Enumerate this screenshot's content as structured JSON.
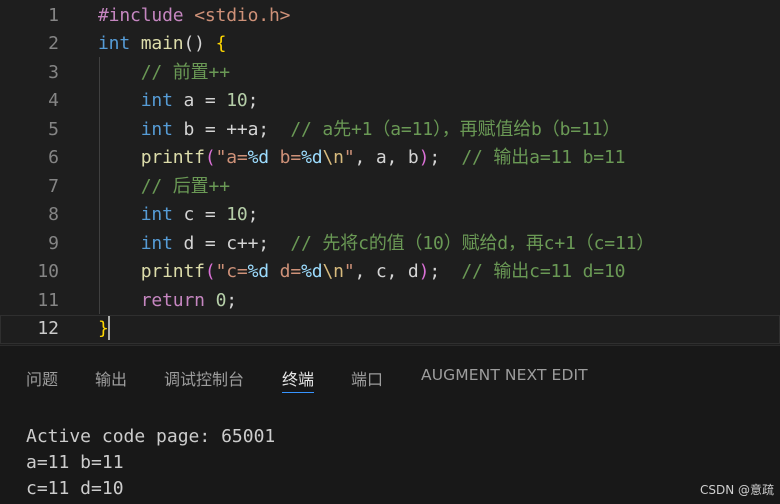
{
  "editor": {
    "lines": [
      {
        "n": "1",
        "tokens": [
          {
            "t": "#include",
            "c": "pp"
          },
          {
            "t": " ",
            "c": "pl"
          },
          {
            "t": "<stdio.h>",
            "c": "str"
          }
        ]
      },
      {
        "n": "2",
        "tokens": [
          {
            "t": "int",
            "c": "kw"
          },
          {
            "t": " ",
            "c": "pl"
          },
          {
            "t": "main",
            "c": "fn"
          },
          {
            "t": "() ",
            "c": "pl"
          },
          {
            "t": "{",
            "c": "br1"
          }
        ]
      },
      {
        "n": "3",
        "tokens": [
          {
            "t": "    ",
            "c": "pl"
          },
          {
            "t": "// 前置++",
            "c": "cm"
          }
        ]
      },
      {
        "n": "4",
        "tokens": [
          {
            "t": "    ",
            "c": "pl"
          },
          {
            "t": "int",
            "c": "kw"
          },
          {
            "t": " a = ",
            "c": "pl"
          },
          {
            "t": "10",
            "c": "num"
          },
          {
            "t": ";",
            "c": "pl"
          }
        ]
      },
      {
        "n": "5",
        "tokens": [
          {
            "t": "    ",
            "c": "pl"
          },
          {
            "t": "int",
            "c": "kw"
          },
          {
            "t": " b = ++a;  ",
            "c": "pl"
          },
          {
            "t": "// a先+1（a=11），再赋值给b（b=11）",
            "c": "cm"
          }
        ]
      },
      {
        "n": "6",
        "tokens": [
          {
            "t": "    ",
            "c": "pl"
          },
          {
            "t": "printf",
            "c": "fn"
          },
          {
            "t": "(",
            "c": "br2"
          },
          {
            "t": "\"a=",
            "c": "str"
          },
          {
            "t": "%d",
            "c": "fmt"
          },
          {
            "t": " b=",
            "c": "str"
          },
          {
            "t": "%d",
            "c": "fmt"
          },
          {
            "t": "\\n",
            "c": "esc"
          },
          {
            "t": "\"",
            "c": "str"
          },
          {
            "t": ", a, b",
            "c": "pl"
          },
          {
            "t": ")",
            "c": "br2"
          },
          {
            "t": ";  ",
            "c": "pl"
          },
          {
            "t": "// 输出a=11 b=11",
            "c": "cm"
          }
        ]
      },
      {
        "n": "7",
        "tokens": [
          {
            "t": "    ",
            "c": "pl"
          },
          {
            "t": "// 后置++",
            "c": "cm"
          }
        ]
      },
      {
        "n": "8",
        "tokens": [
          {
            "t": "    ",
            "c": "pl"
          },
          {
            "t": "int",
            "c": "kw"
          },
          {
            "t": " c = ",
            "c": "pl"
          },
          {
            "t": "10",
            "c": "num"
          },
          {
            "t": ";",
            "c": "pl"
          }
        ]
      },
      {
        "n": "9",
        "tokens": [
          {
            "t": "    ",
            "c": "pl"
          },
          {
            "t": "int",
            "c": "kw"
          },
          {
            "t": " d = c++;  ",
            "c": "pl"
          },
          {
            "t": "// 先将c的值（10）赋给d，再c+1（c=11）",
            "c": "cm"
          }
        ]
      },
      {
        "n": "10",
        "tokens": [
          {
            "t": "    ",
            "c": "pl"
          },
          {
            "t": "printf",
            "c": "fn"
          },
          {
            "t": "(",
            "c": "br2"
          },
          {
            "t": "\"c=",
            "c": "str"
          },
          {
            "t": "%d",
            "c": "fmt"
          },
          {
            "t": " d=",
            "c": "str"
          },
          {
            "t": "%d",
            "c": "fmt"
          },
          {
            "t": "\\n",
            "c": "esc"
          },
          {
            "t": "\"",
            "c": "str"
          },
          {
            "t": ", c, d",
            "c": "pl"
          },
          {
            "t": ")",
            "c": "br2"
          },
          {
            "t": ";  ",
            "c": "pl"
          },
          {
            "t": "// 输出c=11 d=10",
            "c": "cm"
          }
        ]
      },
      {
        "n": "11",
        "tokens": [
          {
            "t": "    ",
            "c": "pl"
          },
          {
            "t": "return",
            "c": "pp"
          },
          {
            "t": " ",
            "c": "pl"
          },
          {
            "t": "0",
            "c": "num"
          },
          {
            "t": ";",
            "c": "pl"
          }
        ]
      },
      {
        "n": "12",
        "tokens": [
          {
            "t": "}",
            "c": "br1"
          }
        ]
      }
    ]
  },
  "panel": {
    "tabs": [
      "问题",
      "输出",
      "调试控制台",
      "终端",
      "端口",
      "AUGMENT NEXT EDIT"
    ],
    "active_tab": "终端"
  },
  "terminal": {
    "lines": [
      "Active code page: 65001",
      "a=11 b=11",
      "c=11 d=10"
    ]
  },
  "watermark": "CSDN @意疏",
  "colors": {
    "editor_bg": "#1e1e1e",
    "panel_bg": "#181818",
    "active_tab_underline": "#3794ff",
    "comment": "#6a9955",
    "keyword": "#569cd6"
  }
}
